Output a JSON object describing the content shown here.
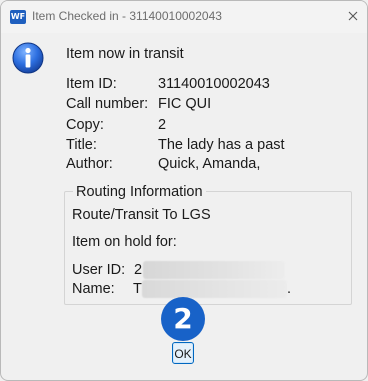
{
  "window": {
    "app_icon_text": "WF",
    "title": "Item Checked in - 31140010002043"
  },
  "message": {
    "headline": "Item now in transit",
    "fields": [
      {
        "label": "Item ID:",
        "value": "31140010002043"
      },
      {
        "label": "Call number:",
        "value": "FIC QUI"
      },
      {
        "label": "Copy:",
        "value": "2"
      },
      {
        "label": "Title:",
        "value": "The lady has a past"
      },
      {
        "label": "Author:",
        "value": "Quick, Amanda,"
      }
    ]
  },
  "routing": {
    "group_title": "Routing Information",
    "route_text": "Route/Transit To LGS",
    "hold_text": "Item on hold for:",
    "user_id_label": "User ID:",
    "user_id_value": "2",
    "name_label": "Name:",
    "name_value": "T",
    "name_trailing": "."
  },
  "step_badge": "2",
  "buttons": {
    "ok_label": "OK"
  },
  "icons": {
    "app": "app-icon",
    "close": "close-icon",
    "info": "info-icon"
  },
  "colors": {
    "badge": "#1862c8",
    "ok_border": "#0067c0"
  }
}
